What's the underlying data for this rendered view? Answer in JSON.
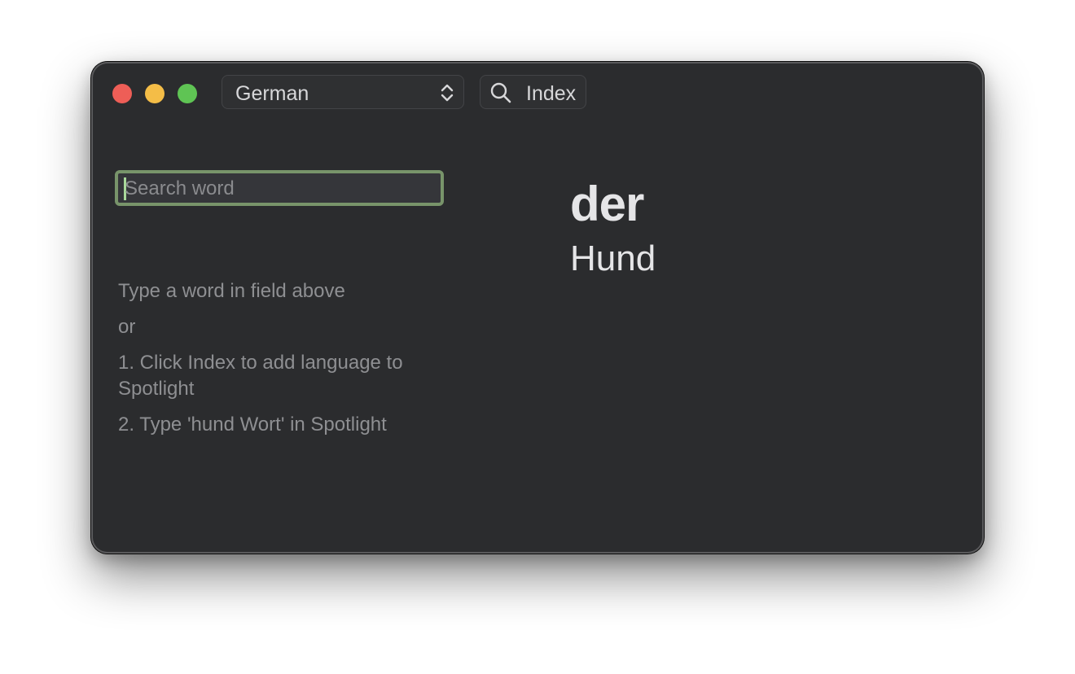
{
  "window": {
    "controls": [
      "close",
      "minimize",
      "maximize"
    ]
  },
  "toolbar": {
    "language_select": {
      "value": "German",
      "icon": "chevron-up-down-icon"
    },
    "index_button": {
      "label": "Index",
      "icon": "magnifying-glass-icon"
    }
  },
  "search": {
    "placeholder": "Search word",
    "value": "",
    "focus_ring_color": "#78946a"
  },
  "help": {
    "line1": "Type a word in field above",
    "line2": "or",
    "step1": "1. Click Index to add language to Spotlight",
    "step2": "2. Type 'hund Wort' in Spotlight"
  },
  "result": {
    "article": "der",
    "noun": "Hund"
  },
  "colors": {
    "window_bg": "#2b2c2e",
    "close": "#ee5e57",
    "minimize": "#f4bd47",
    "maximize": "#5fc454"
  }
}
